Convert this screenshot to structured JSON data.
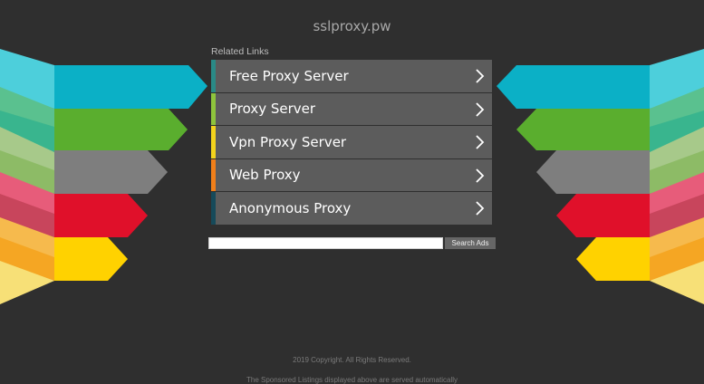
{
  "header": {
    "domain": "sslproxy.pw"
  },
  "related": {
    "heading": "Related Links",
    "items": [
      {
        "label": "Free Proxy Server",
        "accent": "#2a8a86"
      },
      {
        "label": "Proxy Server",
        "accent": "#8ec43c"
      },
      {
        "label": "Vpn Proxy Server",
        "accent": "#f3d31c"
      },
      {
        "label": "Web Proxy",
        "accent": "#f07f1a"
      },
      {
        "label": "Anonymous Proxy",
        "accent": "#164a5a"
      }
    ]
  },
  "search": {
    "value": "",
    "button_label": "Search Ads"
  },
  "footer": {
    "copyright": "2019 Copyright. All Rights Reserved.",
    "disclaimer": "The Sponsored Listings displayed above are served automatically"
  },
  "decor_colors": [
    "#0bb0c6",
    "#5aae2e",
    "#7e7e7e",
    "#e0102a",
    "#ffd200"
  ]
}
